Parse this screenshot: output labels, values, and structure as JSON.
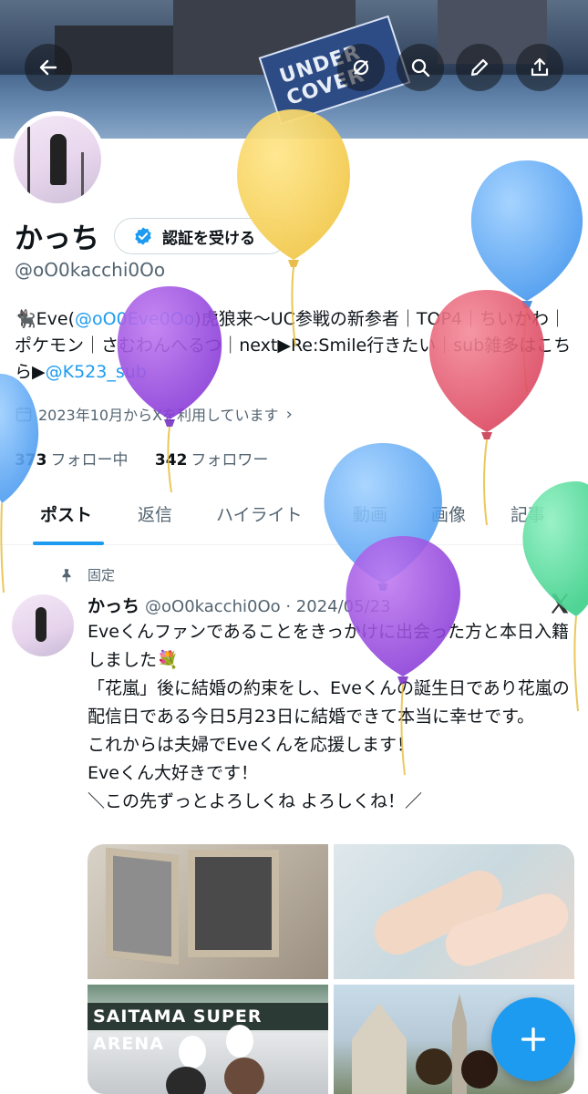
{
  "profile": {
    "name": "かっち",
    "verify_label": "認証を受ける",
    "handle": "@oO0kacchi0Oo",
    "bio_parts": {
      "p1": "🐈‍⬛Eve(",
      "link1": "@oO0Eve0Oo",
      "p2": ")虎狼来〜UC参戦の新参者｜TOP4｜ちいかわ｜ポケモン｜さむわんへるつ｜next▶Re:Smile行きたい｜sub雑多はこちら▶",
      "link2": "@K523_sub"
    },
    "joined": "2023年10月からXを利用しています",
    "following_count": "373",
    "following_label": "フォロー中",
    "followers_count": "342",
    "followers_label": "フォロワー"
  },
  "banner": {
    "flag_text": "UNDER COVER"
  },
  "tabs": [
    "ポスト",
    "返信",
    "ハイライト",
    "動画",
    "画像",
    "記事"
  ],
  "post": {
    "pinned_label": "固定",
    "author": "かっち",
    "handle_date": "@oO0kacchi0Oo · 2024/05/23",
    "text": "Eveくんファンであることをきっかけに出会った方と本日入籍しました💐\n「花嵐」後に結婚の約束をし、Eveくんの誕生日であり花嵐の配信日である今日5月23日に結婚できて本当に幸せです。\nこれからは夫婦でEveくんを応援します！\nEveくん大好きです！\n＼この先ずっとよろしくね よろしくね！／",
    "image3_text": "SAITAMA SUPER ARENA"
  },
  "colors": {
    "accent": "#1d9bf0",
    "text": "#0f1419",
    "muted": "#536471"
  }
}
